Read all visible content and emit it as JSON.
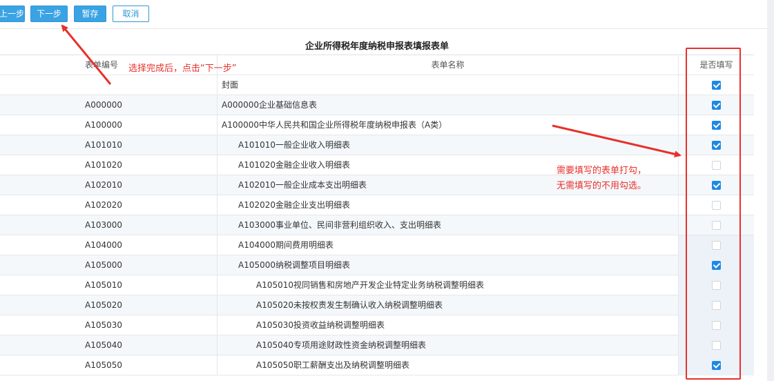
{
  "toolbar": {
    "prev_label": "上一步",
    "next_label": "下一步",
    "save_label": "暂存",
    "cancel_label": "取消"
  },
  "page_title": "企业所得税年度纳税申报表填报表单",
  "table": {
    "headers": {
      "code": "表单编号",
      "name": "表单名称",
      "fill": "是否填写"
    },
    "rows": [
      {
        "code": "",
        "name": "封面",
        "indent": 0,
        "checked": true
      },
      {
        "code": "A000000",
        "name": "A000000企业基础信息表",
        "indent": 0,
        "checked": true
      },
      {
        "code": "A100000",
        "name": "A100000中华人民共和国企业所得税年度纳税申报表（A类）",
        "indent": 0,
        "checked": true
      },
      {
        "code": "A101010",
        "name": "A101010一般企业收入明细表",
        "indent": 1,
        "checked": true
      },
      {
        "code": "A101020",
        "name": "A101020金融企业收入明细表",
        "indent": 1,
        "checked": false
      },
      {
        "code": "A102010",
        "name": "A102010一般企业成本支出明细表",
        "indent": 1,
        "checked": true
      },
      {
        "code": "A102020",
        "name": "A102020金融企业支出明细表",
        "indent": 1,
        "checked": false
      },
      {
        "code": "A103000",
        "name": "A103000事业单位、民间非营利组织收入、支出明细表",
        "indent": 1,
        "checked": false
      },
      {
        "code": "A104000",
        "name": "A104000期间费用明细表",
        "indent": 1,
        "checked": false
      },
      {
        "code": "A105000",
        "name": "A105000纳税调整项目明细表",
        "indent": 1,
        "checked": true
      },
      {
        "code": "A105010",
        "name": "A105010视同销售和房地产开发企业特定业务纳税调整明细表",
        "indent": 2,
        "checked": false
      },
      {
        "code": "A105020",
        "name": "A105020未按权责发生制确认收入纳税调整明细表",
        "indent": 2,
        "checked": false
      },
      {
        "code": "A105030",
        "name": "A105030投资收益纳税调整明细表",
        "indent": 2,
        "checked": false
      },
      {
        "code": "A105040",
        "name": "A105040专项用途财政性资金纳税调整明细表",
        "indent": 2,
        "checked": false
      },
      {
        "code": "A105050",
        "name": "A105050职工薪酬支出及纳税调整明细表",
        "indent": 2,
        "checked": true
      }
    ]
  },
  "annotations": {
    "next_hint": "选择完成后，点击“下一步”",
    "check_hint_line1": "需要填写的表单打勾，",
    "check_hint_line2": "无需填写的不用勾选。",
    "color": "#e8302c"
  }
}
